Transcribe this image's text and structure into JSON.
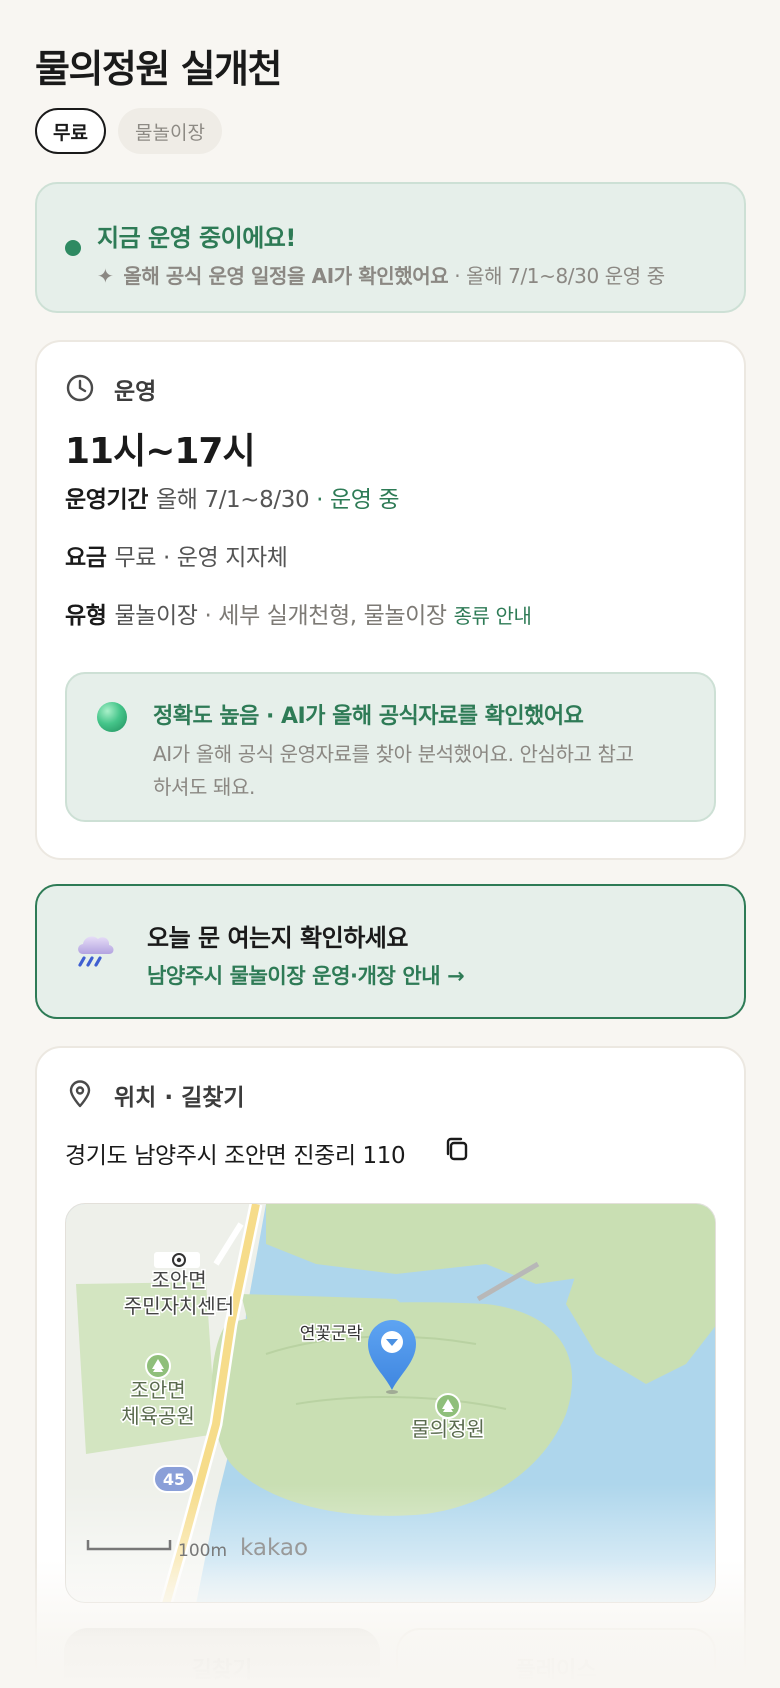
{
  "page": {
    "title": "물의정원 실개천"
  },
  "chips": {
    "free": "무료",
    "type": "물놀이장"
  },
  "live_banner": {
    "title": "지금 운영 중이에요!",
    "sparkle": "✦",
    "sub_bold": "올해 공식 운영 일정을 AI가 확인했어요",
    "sub_rest": " · 올해 7/1~8/30 운영 중"
  },
  "hours_card": {
    "heading": "운영",
    "hours": "11시~17시",
    "period_label": "운영기간",
    "period_value": "올해 7/1~8/30",
    "period_status": " · 운영 중",
    "fee_label": "요금",
    "fee_value": "무료 · 운영 지자체",
    "type_label": "유형",
    "type_value": "물놀이장",
    "type_detail": " · 세부 실개천형, 물놀이장 ",
    "type_link": "종류 안내",
    "accuracy": {
      "title": "정확도 높음 · AI가 올해 공식자료를 확인했어요",
      "body": "AI가 올해 공식 운영자료를 찾아 분석했어요. 안심하고 참고하셔도 돼요."
    }
  },
  "check_banner": {
    "title": "오늘 문 여는지 확인하세요",
    "link": "남양주시 물놀이장 운영·개장 안내 →"
  },
  "location_card": {
    "heading": "위치 · 길찾기",
    "address": "경기도 남양주시 조안면 진중리 110",
    "map": {
      "poi_office": "조안면\n주민자치센터",
      "poi_office_l1": "조안면",
      "poi_office_l2": "주민자치센터",
      "poi_park_l1": "조안면",
      "poi_park_l2": "체육공원",
      "poi_pond": "연꽃군락",
      "poi_garden": "물의정원",
      "road_number": "45",
      "scale": "100m",
      "brand": "kakao"
    }
  },
  "buttons": {
    "directions": "길찾기",
    "place": "플레이스"
  },
  "colors": {
    "accent": "#2e7b56",
    "water": "#aed6ec",
    "land": "#c9dfb3",
    "pin": "#4a90e2"
  }
}
